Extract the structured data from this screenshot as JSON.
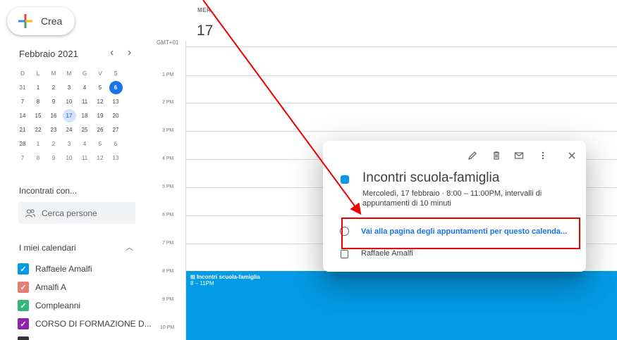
{
  "create_button": {
    "label": "Crea"
  },
  "mini_calendar": {
    "month_label": "Febbraio 2021",
    "prev": "‹",
    "next": "›",
    "weekday_headers": [
      "D",
      "L",
      "M",
      "M",
      "G",
      "V",
      "S"
    ],
    "weeks": [
      [
        "31",
        "1",
        "2",
        "3",
        "4",
        "5",
        "6"
      ],
      [
        "7",
        "8",
        "9",
        "10",
        "11",
        "12",
        "13"
      ],
      [
        "14",
        "15",
        "16",
        "17",
        "18",
        "19",
        "20"
      ],
      [
        "21",
        "22",
        "23",
        "24",
        "25",
        "26",
        "27"
      ],
      [
        "28",
        "1",
        "2",
        "3",
        "4",
        "5",
        "6"
      ],
      [
        "7",
        "8",
        "9",
        "10",
        "11",
        "12",
        "13"
      ]
    ]
  },
  "meet_with": {
    "title": "Incontrati con...",
    "search_placeholder": "Cerca persone"
  },
  "my_calendars": {
    "title": "I miei calendari",
    "items": [
      {
        "label": "Raffaele Amalfi",
        "color": "#039be5"
      },
      {
        "label": "Amalfi A",
        "color": "#e67c73"
      },
      {
        "label": "Compleanni",
        "color": "#33b679"
      },
      {
        "label": "CORSO DI FORMAZIONE D...",
        "color": "#8e24aa"
      }
    ]
  },
  "day_view": {
    "weekday": "MER",
    "day_number": "17",
    "timezone": "GMT+01",
    "hours": [
      "1 PM",
      "2 PM",
      "3 PM",
      "4 PM",
      "5 PM",
      "6 PM",
      "7 PM",
      "8 PM",
      "9 PM",
      "10 PM"
    ]
  },
  "event_block": {
    "title": "Incontri scuola-famiglia",
    "time": "8 – 11PM",
    "color": "#039be5"
  },
  "event_popup": {
    "title": "Incontri scuola-famiglia",
    "details": "Mercoledì, 17 febbraio  ·  8:00 – 11:00PM, intervalli di appuntamenti di 10 minuti",
    "link": "Vai alla pagina degli appuntamenti per questo calenda...",
    "owner": "Raffaele Amalfi",
    "tools": [
      "edit-icon",
      "delete-icon",
      "email-icon",
      "more-icon",
      "close-icon"
    ]
  },
  "colors": {
    "accent": "#1a73e8",
    "annotation": "#e00000"
  }
}
